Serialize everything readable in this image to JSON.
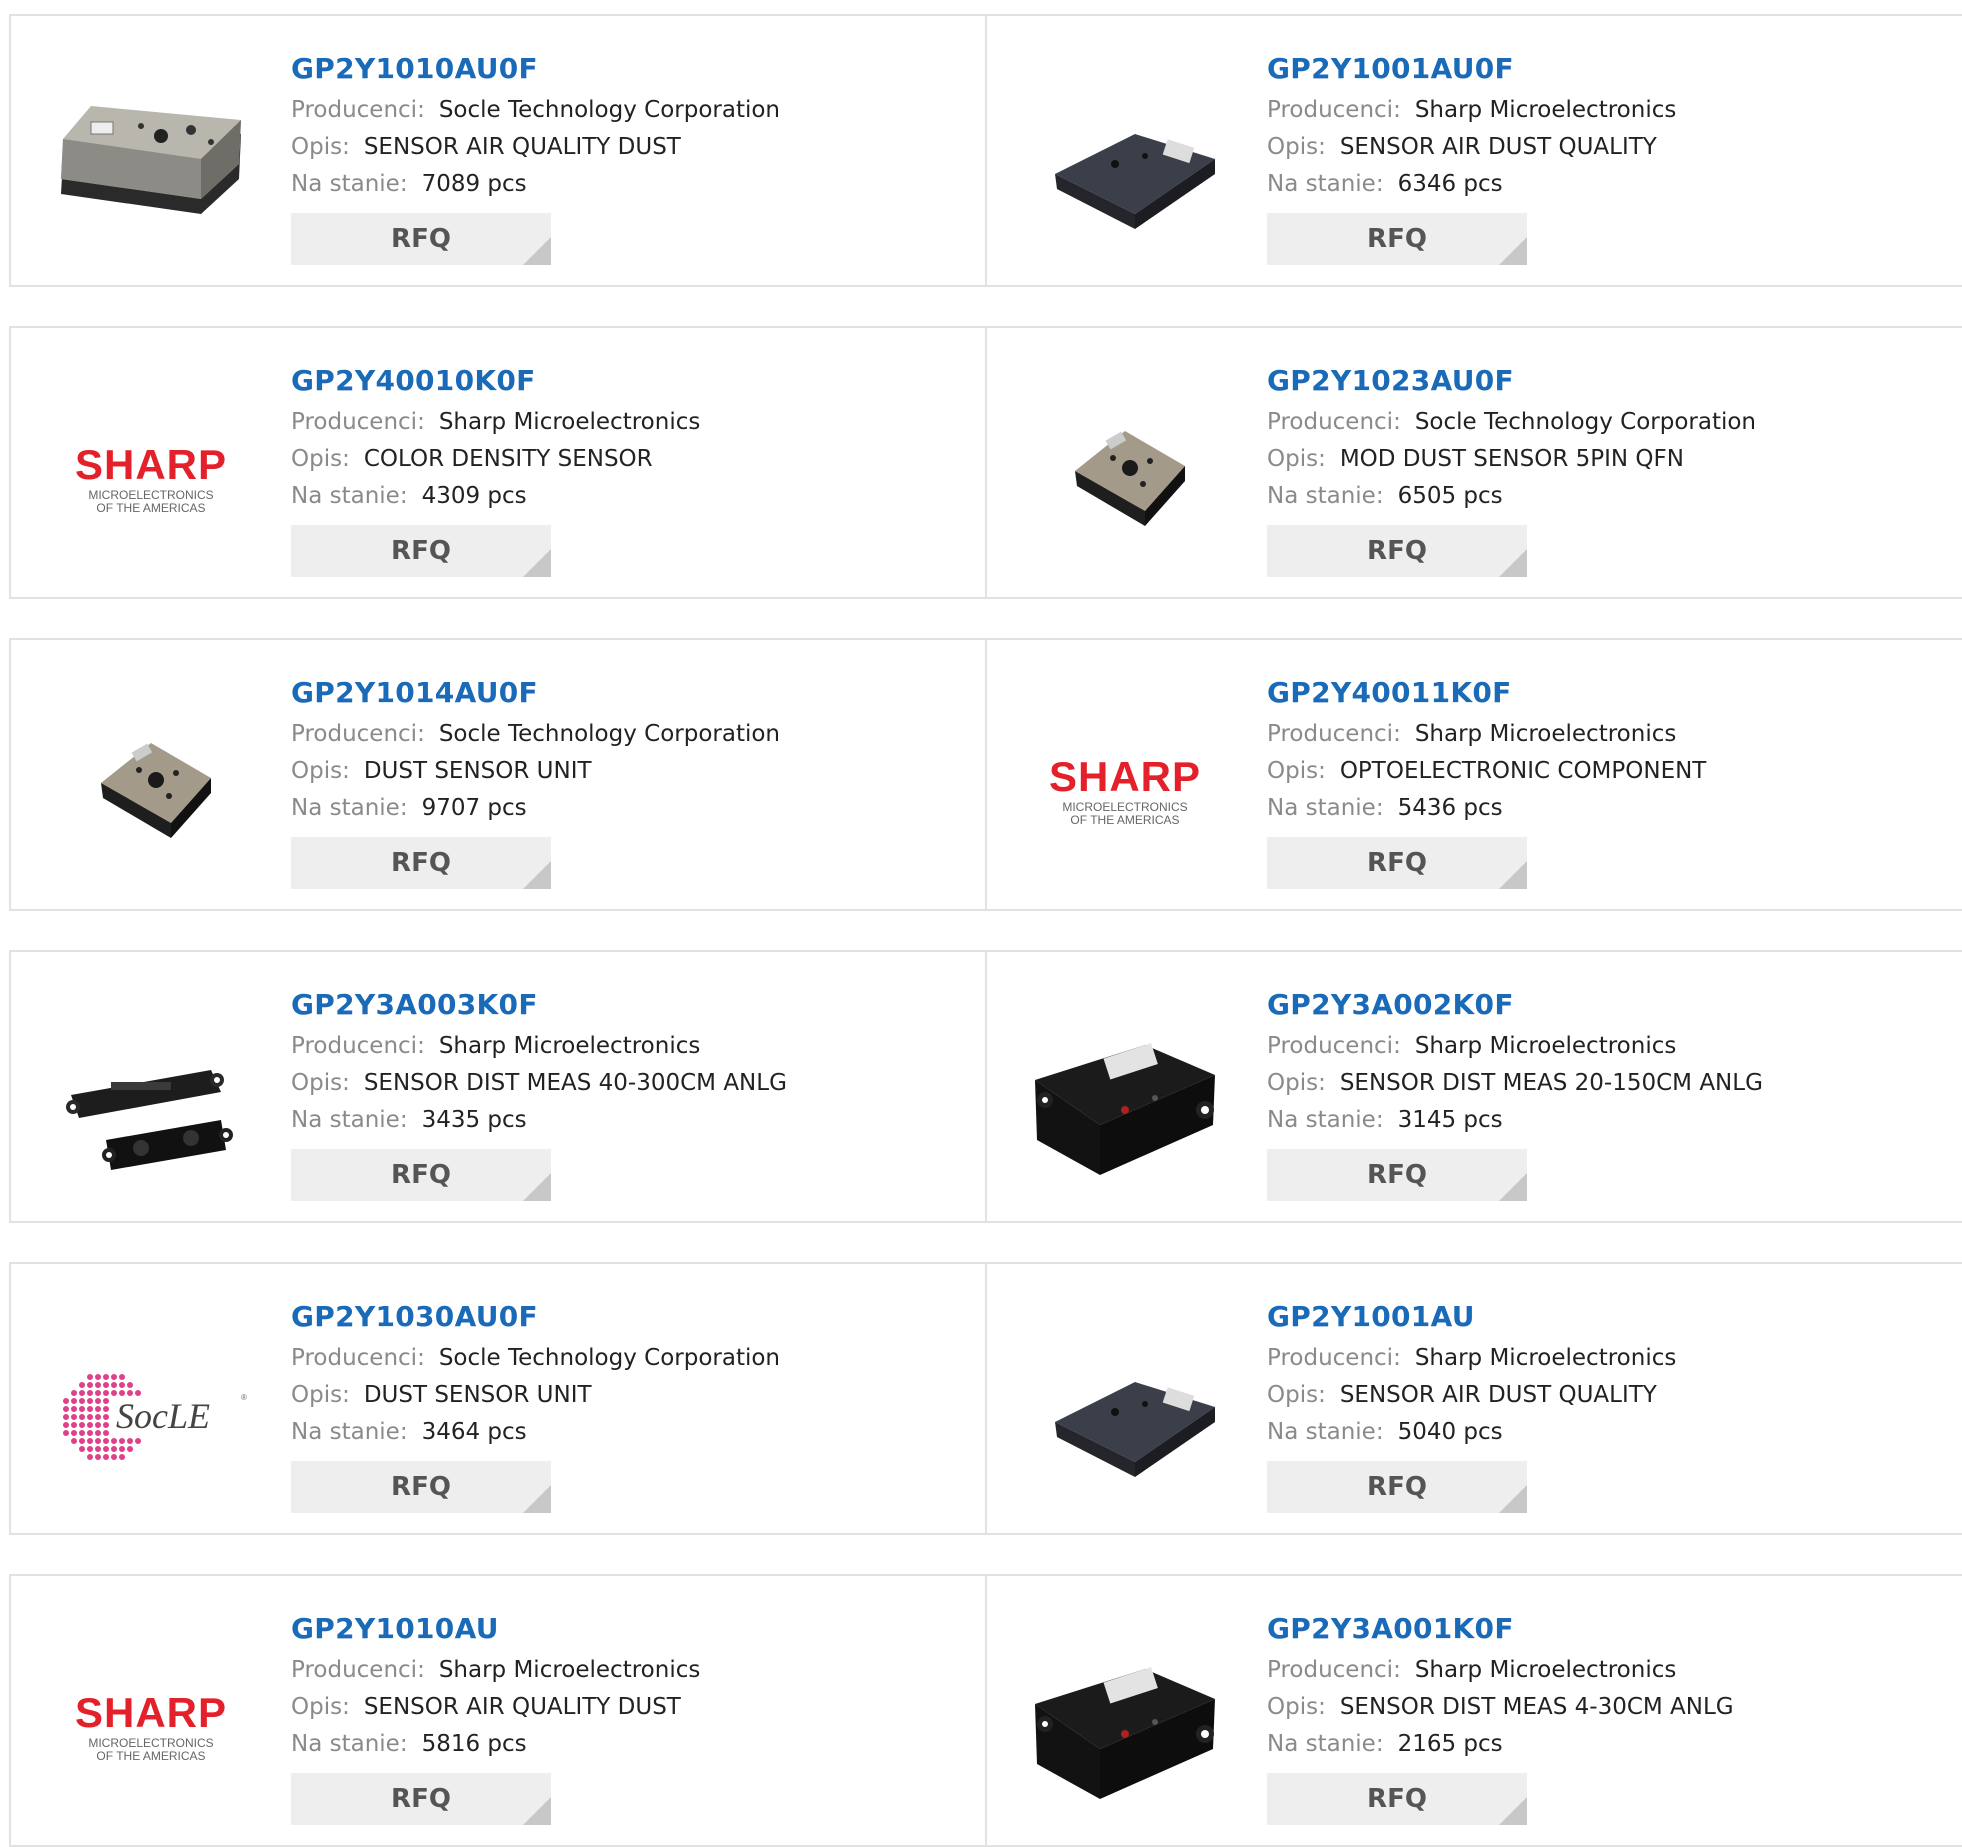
{
  "labels": {
    "manufacturer": "Producenci:",
    "description": "Opis:",
    "stock": "Na stanie:",
    "rfq": "RFQ"
  },
  "colors": {
    "part_link": "#1a6ab8",
    "label": "#8a8a8a",
    "rfq_bg": "#eeeeee",
    "border": "#e2e2e2",
    "sharp_red": "#e4202a",
    "socle_pink": "#e0408a"
  },
  "products": [
    {
      "part": "GP2Y1010AU0F",
      "manufacturer": "Socle Technology Corporation",
      "description": "SENSOR AIR QUALITY DUST",
      "stock": "7089 pcs",
      "image": "dust-sensor-grey-photo"
    },
    {
      "part": "GP2Y1001AU0F",
      "manufacturer": "Sharp Microelectronics",
      "description": "SENSOR AIR DUST QUALITY",
      "stock": "6346 pcs",
      "image": "dust-sensor-dark-photo"
    },
    {
      "part": "GP2Y40010K0F",
      "manufacturer": "Sharp Microelectronics",
      "description": "COLOR DENSITY SENSOR",
      "stock": "4309 pcs",
      "image": "sharp-logo"
    },
    {
      "part": "GP2Y1023AU0F",
      "manufacturer": "Socle Technology Corporation",
      "description": "MOD DUST SENSOR 5PIN QFN",
      "stock": "6505 pcs",
      "image": "dust-sensor-small-photo"
    },
    {
      "part": "GP2Y1014AU0F",
      "manufacturer": "Socle Technology Corporation",
      "description": "DUST SENSOR UNIT",
      "stock": "9707 pcs",
      "image": "dust-sensor-small-photo"
    },
    {
      "part": "GP2Y40011K0F",
      "manufacturer": "Sharp Microelectronics",
      "description": "OPTOELECTRONIC COMPONENT",
      "stock": "5436 pcs",
      "image": "sharp-logo"
    },
    {
      "part": "GP2Y3A003K0F",
      "manufacturer": "Sharp Microelectronics",
      "description": "SENSOR DIST MEAS 40-300CM ANLG",
      "stock": "3435 pcs",
      "image": "distance-sensor-pair-photo"
    },
    {
      "part": "GP2Y3A002K0F",
      "manufacturer": "Sharp Microelectronics",
      "description": "SENSOR DIST MEAS 20-150CM ANLG",
      "stock": "3145 pcs",
      "image": "distance-sensor-box-photo"
    },
    {
      "part": "GP2Y1030AU0F",
      "manufacturer": "Socle Technology Corporation",
      "description": "DUST SENSOR UNIT",
      "stock": "3464 pcs",
      "image": "socle-logo"
    },
    {
      "part": "GP2Y1001AU",
      "manufacturer": "Sharp Microelectronics",
      "description": "SENSOR AIR DUST QUALITY",
      "stock": "5040 pcs",
      "image": "dust-sensor-dark-photo"
    },
    {
      "part": "GP2Y1010AU",
      "manufacturer": "Sharp Microelectronics",
      "description": "SENSOR AIR QUALITY DUST",
      "stock": "5816 pcs",
      "image": "sharp-logo"
    },
    {
      "part": "GP2Y3A001K0F",
      "manufacturer": "Sharp Microelectronics",
      "description": "SENSOR DIST MEAS 4-30CM ANLG",
      "stock": "2165 pcs",
      "image": "distance-sensor-box-photo"
    }
  ],
  "logos": {
    "sharp_wordmark": "SHARP",
    "sharp_sub1": "MICROELECTRONICS",
    "sharp_sub2": "OF THE AMERICAS",
    "socle_wordmark": "SocLE"
  }
}
